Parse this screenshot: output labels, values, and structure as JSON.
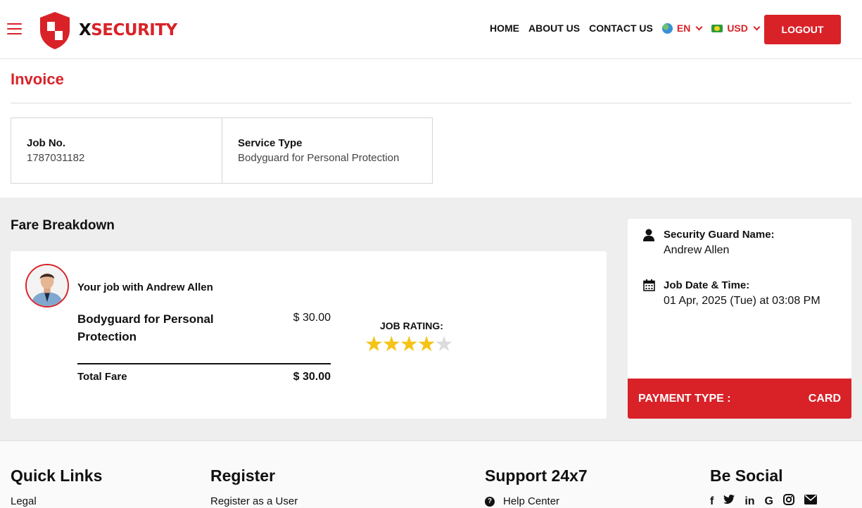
{
  "header": {
    "logo_prefix": "X",
    "logo_suffix": "SECURITY",
    "nav": [
      "HOME",
      "ABOUT US",
      "CONTACT US"
    ],
    "language": "EN",
    "currency": "USD",
    "logout_label": "LOGOUT"
  },
  "invoice": {
    "title": "Invoice",
    "job_no_label": "Job No.",
    "job_no": "1787031182",
    "service_type_label": "Service Type",
    "service_type": "Bodyguard for Personal Protection"
  },
  "fare": {
    "title": "Fare Breakdown",
    "job_with": "Your job with Andrew Allen",
    "service_name": "Bodyguard for Personal Protection",
    "service_price": "$ 30.00",
    "total_label": "Total Fare",
    "total_value": "$ 30.00",
    "rating_label": "JOB RATING:",
    "rating": 4,
    "rating_max": 5
  },
  "guard": {
    "name_label": "Security Guard Name:",
    "name": "Andrew Allen",
    "date_label": "Job Date & Time:",
    "date": "01 Apr, 2025 (Tue) at 03:08 PM",
    "payment_label": "PAYMENT TYPE :",
    "payment_value": "CARD"
  },
  "footer": {
    "quick_links": "Quick Links",
    "quick_link_1": "Legal",
    "register": "Register",
    "register_link_1": "Register as a User",
    "support": "Support 24x7",
    "support_link_1": "Help Center",
    "social": "Be Social",
    "social_icons": [
      "facebook-icon",
      "twitter-icon",
      "linkedin-icon",
      "google-icon",
      "instagram-icon",
      "email-icon"
    ]
  },
  "colors": {
    "brand": "#d92228",
    "star_on": "#f6c316",
    "star_off": "#dcdcdc",
    "panel_bg": "#eeeeee"
  }
}
